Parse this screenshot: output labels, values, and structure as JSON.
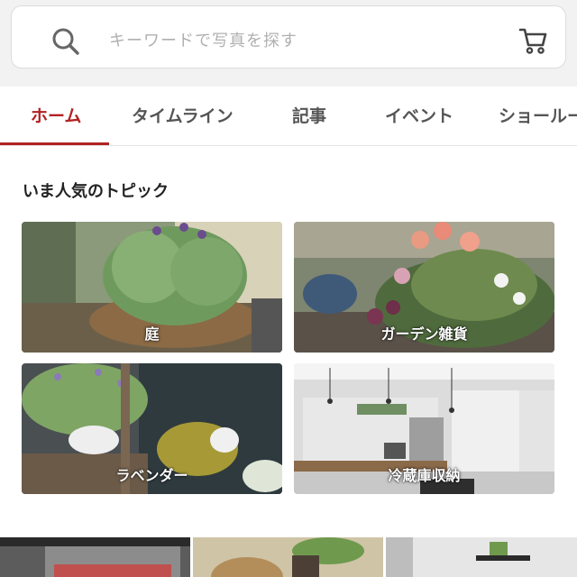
{
  "search": {
    "placeholder": "キーワードで写真を探す"
  },
  "tabs": [
    {
      "label": "ホーム"
    },
    {
      "label": "タイムライン"
    },
    {
      "label": "記事"
    },
    {
      "label": "イベント"
    },
    {
      "label": "ショールーム"
    }
  ],
  "trending": {
    "title": "いま人気のトピック",
    "topics": [
      {
        "label": "庭"
      },
      {
        "label": "ガーデン雑貨"
      },
      {
        "label": "ラベンダー"
      },
      {
        "label": "冷蔵庫収納"
      }
    ]
  },
  "colors": {
    "accent": "#b22222"
  }
}
